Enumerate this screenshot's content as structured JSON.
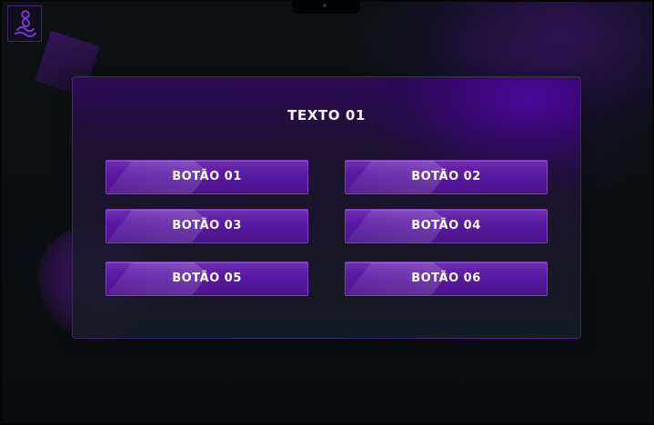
{
  "panel": {
    "title": "TEXTO 01",
    "buttons": [
      {
        "label": "BOTÃO 01"
      },
      {
        "label": "BOTÃO 02"
      },
      {
        "label": "BOTÃO 03"
      },
      {
        "label": "BOTÃO 04"
      },
      {
        "label": "BOTÃO 05"
      },
      {
        "label": "BOTÃO 06"
      }
    ]
  },
  "brand": {
    "icon": "meditation-icon",
    "accent_color": "#5a1a9f",
    "panel_glow_color": "#4d07a0"
  }
}
